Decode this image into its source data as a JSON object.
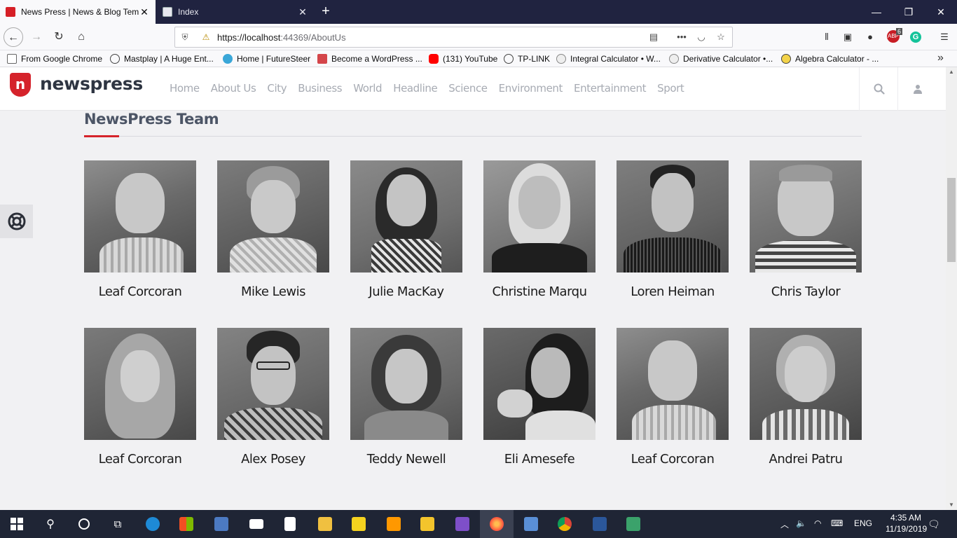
{
  "browser": {
    "tabs": [
      {
        "label": "News Press | News & Blog Tem",
        "active": true
      },
      {
        "label": "Index",
        "active": false
      }
    ],
    "new_tab_symbol": "+",
    "url_host": "https://localhost",
    "url_rest": ":44369/AboutUs",
    "bookmarks": [
      {
        "label": "From Google Chrome",
        "icon": "folder-icon"
      },
      {
        "label": "Mastplay | A Huge Ent...",
        "icon": "globe-icon"
      },
      {
        "label": "Home | FutureSteer",
        "icon": "futuresteer-icon"
      },
      {
        "label": "Become a WordPress ...",
        "icon": "wordpress-icon"
      },
      {
        "label": "(131) YouTube",
        "icon": "youtube-icon"
      },
      {
        "label": "TP-LINK",
        "icon": "globe-icon"
      },
      {
        "label": "Integral Calculator • W...",
        "icon": "calculator-icon"
      },
      {
        "label": "Derivative Calculator •...",
        "icon": "calculator-icon"
      },
      {
        "label": "Algebra Calculator - ...",
        "icon": "calculator-icon"
      }
    ],
    "extension_badge": "6"
  },
  "site": {
    "logo_mark": "n",
    "logo_text": "newspress",
    "nav": [
      "Home",
      "About Us",
      "City",
      "Business",
      "World",
      "Headline",
      "Science",
      "Environment",
      "Entertainment",
      "Sport"
    ],
    "section_title": "NewsPress Team",
    "accent_color": "#d5232b"
  },
  "team": [
    {
      "name": "Leaf Corcoran"
    },
    {
      "name": "Mike Lewis"
    },
    {
      "name": "Julie MacKay"
    },
    {
      "name": "Christine Marqu"
    },
    {
      "name": "Loren Heiman"
    },
    {
      "name": "Chris Taylor"
    },
    {
      "name": "Leaf Corcoran"
    },
    {
      "name": "Alex Posey"
    },
    {
      "name": "Teddy Newell"
    },
    {
      "name": "Eli Amesefe"
    },
    {
      "name": "Leaf Corcoran"
    },
    {
      "name": "Andrei Patru"
    }
  ],
  "taskbar": {
    "language": "ENG",
    "time": "4:35 AM",
    "date": "11/19/2019"
  }
}
